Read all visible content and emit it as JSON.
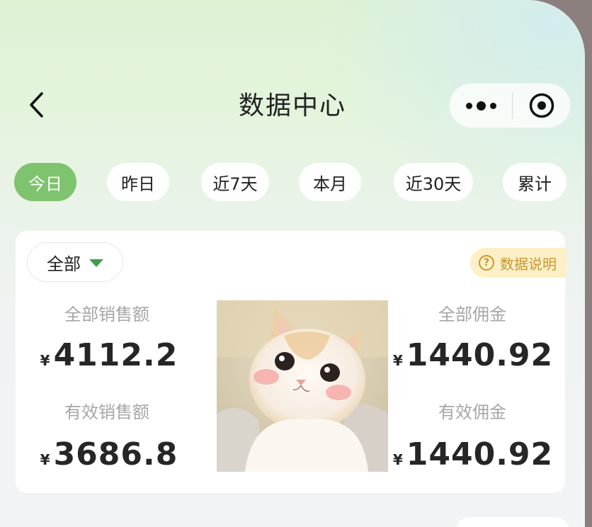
{
  "header": {
    "title": "数据中心"
  },
  "tabs": [
    {
      "label": "今日",
      "active": true
    },
    {
      "label": "昨日",
      "active": false
    },
    {
      "label": "近7天",
      "active": false
    },
    {
      "label": "本月",
      "active": false
    },
    {
      "label": "近30天",
      "active": false
    },
    {
      "label": "累计",
      "active": false
    }
  ],
  "card": {
    "filter_label": "全部",
    "help_label": "数据说明",
    "currency_symbol": "¥",
    "metrics": {
      "total_sales": {
        "label": "全部销售额",
        "value": "4112.2"
      },
      "valid_sales": {
        "label": "有效销售额",
        "value": "3686.8"
      },
      "total_commission": {
        "label": "全部佣金",
        "value": "1440.92"
      },
      "valid_commission": {
        "label": "有效佣金",
        "value": "1440.92"
      }
    }
  },
  "colors": {
    "accent": "#7ec36e",
    "help_bg": "#fdf0c6",
    "help_text": "#c9962f"
  },
  "icons": [
    "back-chevron-icon",
    "more-dots-icon",
    "target-circle-icon",
    "dropdown-triangle-icon",
    "question-circle-icon"
  ]
}
